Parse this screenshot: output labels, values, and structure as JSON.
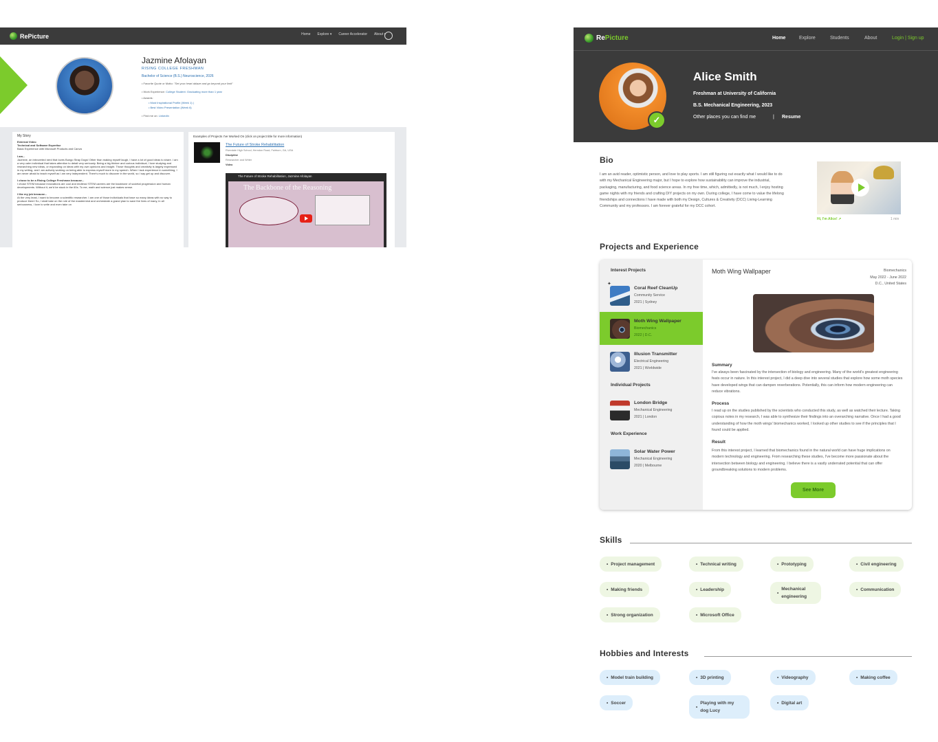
{
  "old_page": {
    "nav": {
      "brand": "RePicture",
      "menu": [
        "Home",
        "Explore ▾",
        "Career Accelerator",
        "About ▾"
      ]
    },
    "profile": {
      "name": "Jazmine Afolayan",
      "role": "RISING COLLEGE FRESHMAN",
      "degree": "Bachelor of Science (B.S.) Neuroscience, 2026",
      "quote_label": "• Favorite Quote or Motto:",
      "quote": "\"Set your heart ablaze and go beyond your limit\"",
      "work_label": "• Work Experience:",
      "work": "College Student: Graduating more than 1 year",
      "awards_label": "• Awards:",
      "awards": [
        "• Most Inspirational Profile (Week 1)  |",
        "• Best Video Presentation (Week 6)"
      ],
      "find_label": "• Find me on:",
      "find": "LinkedIn"
    },
    "story": {
      "title": "My Story",
      "ext_video": "External Video",
      "tech_title": "Technical and Software Expertise",
      "tech": "Basic Experience with Microsoft Products and Canva",
      "i_am": "I am...",
      "i_am_text": "Jazmine, an introverted nerd that loves Bungo Stray Dogs! Other than making myself laugh, I have a lot of good ideas to share. I am a very calm individual that takes attention to detail very seriously. Being a big thinker and curious individual, I love studying and researching new ideas, or expanding on ideas with my own opinions and insight. Those thoughts and creativity is largely expressed in my writing, and I am actively working on being able to express myself more in my speech. When I lack experience in something, I am never afraid to teach myself as I am very independent. There's much to discover in the world, so I say get up and discover.",
      "chose": "I chose to be a Rising College Freshman because...",
      "chose_text": "I chose STEM because innovations are cool and endless! STEM careers are the backbone of societal progression and human developments. Without it, we'd be stuck in the 60s. To me, math and science just makes sense.",
      "like": "I like my job because...",
      "like_text": "At the very least, I want to become a scientific researcher. I am one of those individuals that have so many ideas with no way to produce them! So, I shall take on the role of the mastermind and orchestrate a grand plan to save the lives of many, in all seriousness, I love to write and even take on"
    },
    "projects": {
      "title": "Examples of Projects I've Worked On (click on project title for more information)",
      "project_title": "The Future of Stroke Rehabilitation",
      "project_meta": "Riverdale High School, Herndon Road, Fairburn, GA, USA",
      "discipline_label": "Discipline",
      "discipline": "Researcher and Writer",
      "video_label": "Video",
      "video_bar": "The Future of Stroke Rehabilitation, Jazmine Afolayan",
      "video_slide": "The Backbone of the Reasoning"
    }
  },
  "new_page": {
    "nav": {
      "brand_a": "Re",
      "brand_b": "Picture",
      "items": [
        "Home",
        "Explore",
        "Students",
        "About"
      ],
      "login": "Login | Sign up"
    },
    "hero": {
      "name": "Alice Smith",
      "line1": "Freshman at University of California",
      "line2": "B.S. Mechanical Engineering, 2023",
      "line3": "Other places you can find me",
      "sep": "|",
      "resume": "Resume",
      "badge": "✓"
    },
    "bio": {
      "title": "Bio",
      "text": "I am an avid reader, optimistic person, and love to play sports. I am still figuring out exactly what I would like to do with my Mechanical Engineering major, but I hope to explore how sustainability can improve the industrial, packaging, manufacturing, and food science areas. In my free time, which, admittedly, is not much, I enjoy hosting game nights with my friends and crafting DIY projects on my own. During college, I have come to value the lifelong friendships and connections I have made with both my Design, Cultures & Creativity (DCC) Living-Learning Community and my professors. I am forever grateful for my DCC cohort.",
      "video_caption": "Hi, I'm Alice!",
      "video_duration": "1 min"
    },
    "projects": {
      "title": "Projects and Experience",
      "interest_head": "Interest Projects",
      "individual_head": "Individual Projects",
      "work_head": "Work Experience",
      "items": [
        {
          "name": "Coral Reef CleanUp",
          "sub": "Community Service",
          "meta": "2021 | Sydney"
        },
        {
          "name": "Moth Wing Wallpaper",
          "sub": "Biomechanics",
          "meta": "2022 | D.C."
        },
        {
          "name": "Illusion Transmitter",
          "sub": "Electrical Engineering",
          "meta": "2021 | Worldwide"
        },
        {
          "name": "London Bridge",
          "sub": "Mechanical Engineering",
          "meta": "2021 | London"
        },
        {
          "name": "Solar Water Power",
          "sub": "Mechanical Engineering",
          "meta": "2020 | Melbourne"
        }
      ],
      "detail": {
        "title": "Moth Wing Wallpaper",
        "discipline": "Biomechanics",
        "dates": "May 2022 - June 2022",
        "location": "D.C., United States",
        "summary_h": "Summary",
        "summary": "I've always been fascinated by the intersection of biology and engineering. Many of the world's greatest engineering feats occur in nature. In this interest project, I did a deep dive into several studies that explore how some moth species have developed wings that can dampen reverberations. Potentially, this can inform how modern engineering can reduce vibrations.",
        "process_h": "Process",
        "process": "I read up on the studies published by the scientists who conducted this study, as well as watched their lecture. Taking copious notes in my research, I was able to synthesize their findings into an overarching narrative. Once I had a good understanding of how the moth wings' biomechanics worked, I looked up other studies to see if the principles that I found could be applied.",
        "result_h": "Result",
        "result": "From this interest project, I learned that biomechanics found in the natural world can have huge implications on modern technology and engineering. From researching these studies, I've become more passionate about the intersection between biology and engineering. I believe there is a vastly underrated potential that can offer groundbreaking solutions to modern problems.",
        "see_more": "See More"
      }
    },
    "skills": {
      "title": "Skills",
      "items": [
        "Project management",
        "Technical writing",
        "Prototyping",
        "Civil engineering",
        "Making friends",
        "Leadership",
        "Mechanical engineering",
        "Communication",
        "Strong organization",
        "Microsoft Office"
      ]
    },
    "hobbies": {
      "title": "Hobbies and Interests",
      "items": [
        "Model train building",
        "3D printing",
        "Videography",
        "Making coffee",
        "Soccer",
        "Playing with my dog Lucy",
        "Digital art"
      ]
    },
    "colors": {
      "accent": "#7ccb2c",
      "dark": "#3b3b3b",
      "skill_chip": "#eef6e3",
      "hobby_chip": "#ddeefb"
    }
  }
}
